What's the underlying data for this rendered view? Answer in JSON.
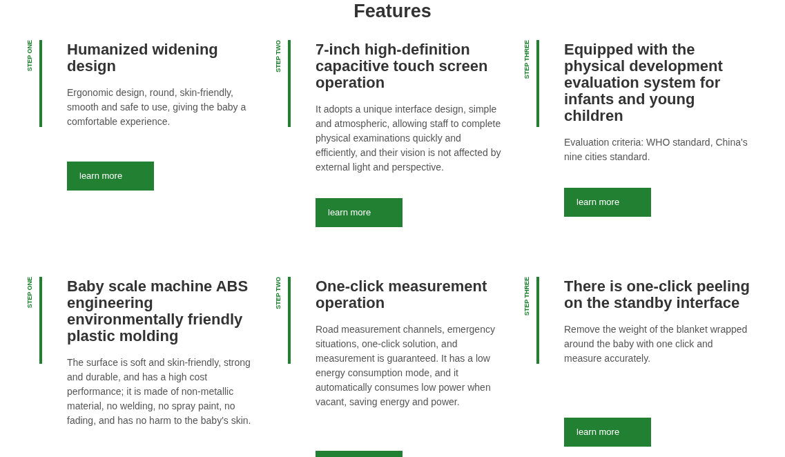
{
  "heading": "Features",
  "rows": [
    {
      "cards": [
        {
          "step": "STEP ONE",
          "title": "Humanized widening design",
          "body": "Ergonomic design, round, skin-friendly, smooth and safe to use, giving the baby a comfortable experience.",
          "button": {
            "label": "learn more"
          }
        },
        {
          "step": "STEP TWO",
          "title": "7-inch high-definition capacitive touch screen operation",
          "body": "It adopts a unique interface design, simple and atmospheric, allowing staff to complete physical examinations quickly and efficiently, and their vision is not affected by external light and perspective.",
          "button": {
            "label": "learn more"
          }
        },
        {
          "step": "STEP THREE",
          "title": "Equipped with the physical development evaluation system for infants and young children",
          "body": "Evaluation criteria: WHO standard, China's nine cities standard.",
          "button": {
            "label": "learn more"
          }
        }
      ]
    },
    {
      "cards": [
        {
          "step": "STEP ONE",
          "title": "Baby scale machine ABS engineering environmentally friendly plastic molding",
          "body": "The surface is soft and skin-friendly, strong and durable, and has a high cost performance; it is made of non-metallic material, no welding, no spray paint, no fading, and has no harm to the baby's skin."
        },
        {
          "step": "STEP TWO",
          "title": "One-click measurement operation",
          "body": "Road measurement channels, emergency situations, one-click solution, and measurement is guaranteed. It has a low energy consumption mode, and it automatically consumes low power when vacant, saving energy and power.",
          "button": {
            "cut_off": true
          }
        },
        {
          "step": "STEP THREE",
          "title": "There is one-click peeling on the standby interface",
          "body": "Remove the weight of the blanket wrapped around the baby with one click and measure accurately.",
          "button": {
            "label": "learn more"
          }
        }
      ]
    }
  ]
}
